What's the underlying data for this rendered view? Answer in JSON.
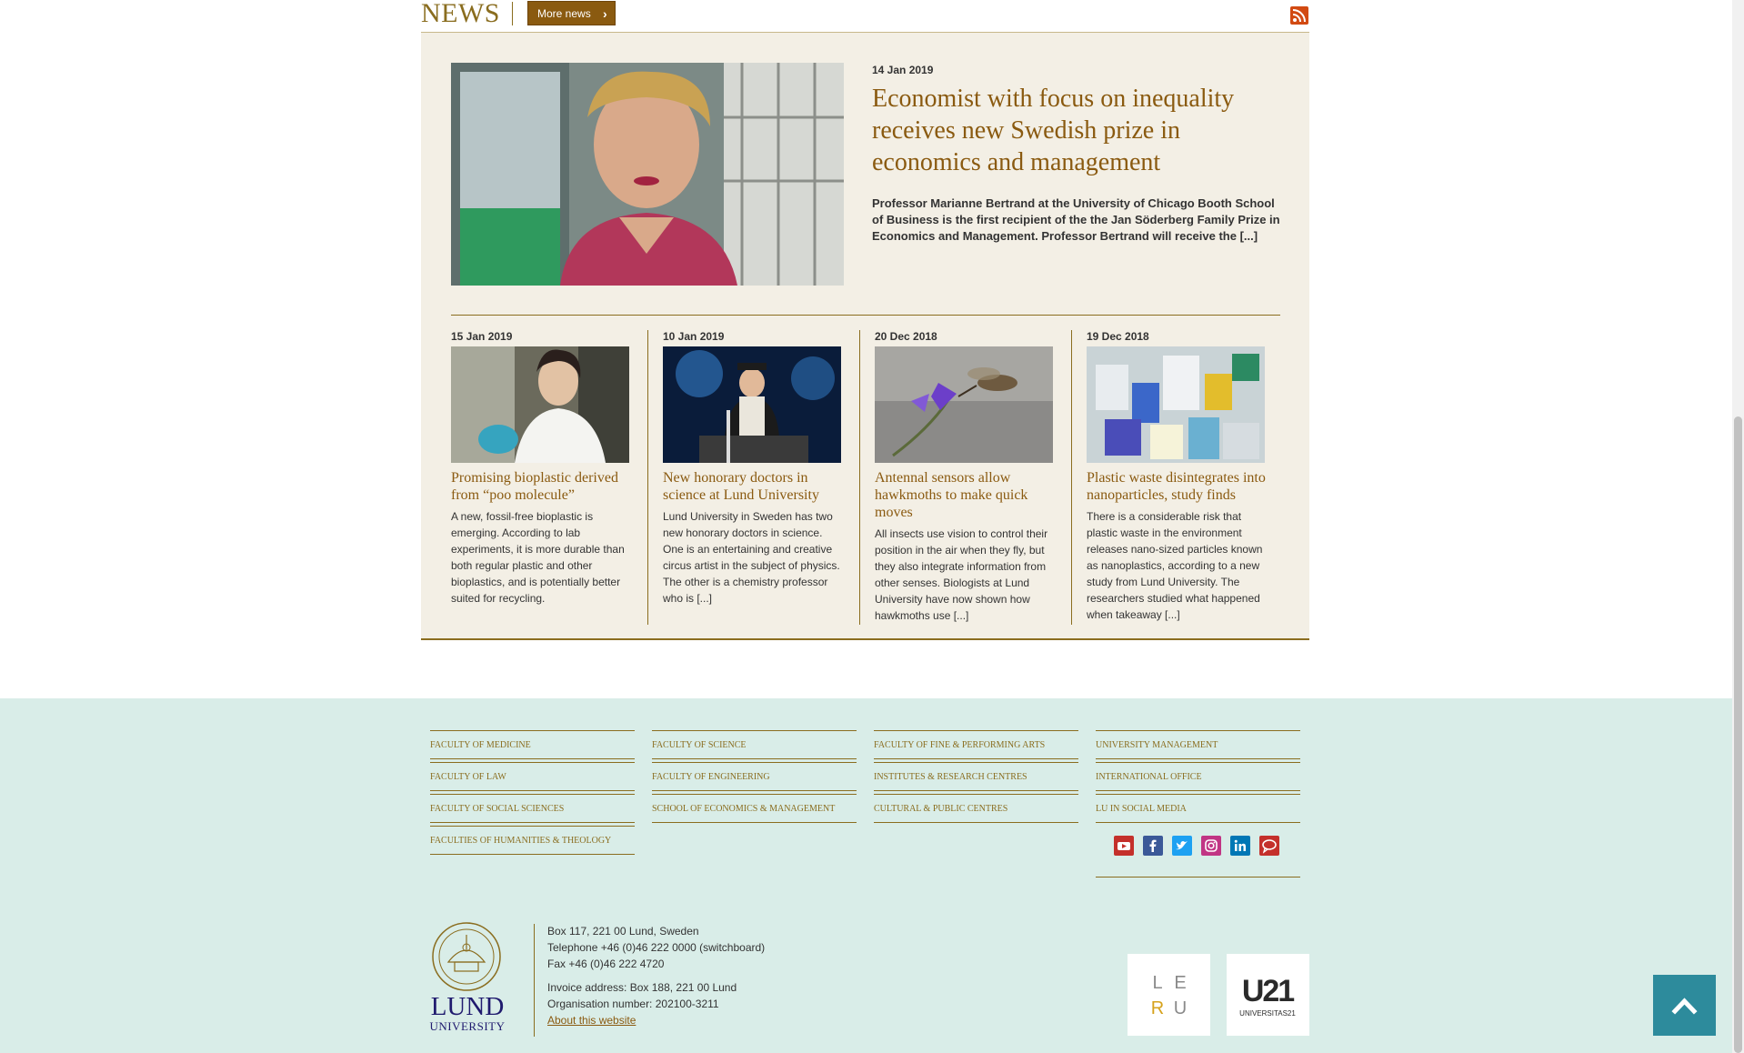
{
  "news": {
    "heading": "NEWS",
    "more_news_label": "More news",
    "featured": {
      "date": "14 Jan 2019",
      "title": "Economist with focus on inequality receives new Swedish prize in economics and management",
      "text": "Professor Marianne Bertrand at the University of Chicago Booth School of Business is the first recipient of the the Jan Söderberg Family Prize in Economics and Management. Professor Bertrand will receive the [...]"
    },
    "cards": [
      {
        "date": "15 Jan 2019",
        "title": "Promising bioplastic derived from “poo molecule”",
        "text": "A new, fossil-free bioplastic is emerging. According to lab experiments, it is more durable than both regular plastic and other bioplastics, and is potentially better suited for recycling."
      },
      {
        "date": "10 Jan 2019",
        "title": "New honorary doctors in science at Lund University",
        "text": "Lund University in Sweden has two new honorary doctors in science. One is an entertaining and creative circus artist in the subject of physics. The other is a chemistry professor who is [...]"
      },
      {
        "date": "20 Dec 2018",
        "title": "Antennal sensors allow hawkmoths to make quick moves",
        "text": "All insects use vision to control their position in the air when they fly, but they also integrate information from other senses. Biologists at Lund University have now shown how hawkmoths use [...]"
      },
      {
        "date": "19 Dec 2018",
        "title": "Plastic waste disintegrates into nanoparticles, study finds",
        "text": "There is a considerable risk that plastic waste in the environment releases nano-sized particles known as nanoplastics, according to a new study from Lund University. The researchers studied what happened when takeaway [...]"
      }
    ]
  },
  "footer": {
    "columns": [
      [
        "FACULTY OF MEDICINE",
        "FACULTY OF LAW",
        "FACULTY OF SOCIAL SCIENCES",
        "FACULTIES OF HUMANITIES & THEOLOGY"
      ],
      [
        "FACULTY OF SCIENCE",
        "FACULTY OF ENGINEERING",
        "SCHOOL OF ECONOMICS & MANAGEMENT"
      ],
      [
        "FACULTY OF FINE & PERFORMING ARTS",
        "INSTITUTES & RESEARCH CENTRES",
        "CULTURAL & PUBLIC CENTRES"
      ],
      [
        "UNIVERSITY MANAGEMENT",
        "INTERNATIONAL OFFICE",
        "LU IN SOCIAL MEDIA"
      ]
    ],
    "social_icons": [
      "youtube-icon",
      "facebook-icon",
      "twitter-icon",
      "instagram-icon",
      "linkedin-icon",
      "chat-icon"
    ],
    "social_colors": [
      "#c4302b",
      "#3b5998",
      "#1da1f2",
      "#c13584",
      "#0077b5",
      "#c4302b"
    ],
    "address": {
      "line1": "Box 117, 221 00 Lund, Sweden",
      "line2": "Telephone +46 (0)46 222 0000 (switchboard)",
      "line3": "Fax +46 (0)46 222 4720",
      "line4": "Invoice address: Box 188, 221 00 Lund",
      "line5": "Organisation number: 202100-3211",
      "about_link": "About this website"
    },
    "logo": {
      "line1": "LUND",
      "line2": "UNIVERSITY"
    },
    "leru_letters": [
      "L",
      "E",
      "R",
      "U"
    ],
    "u21": {
      "big": "U21",
      "small": "UNIVERSITAS21"
    }
  }
}
